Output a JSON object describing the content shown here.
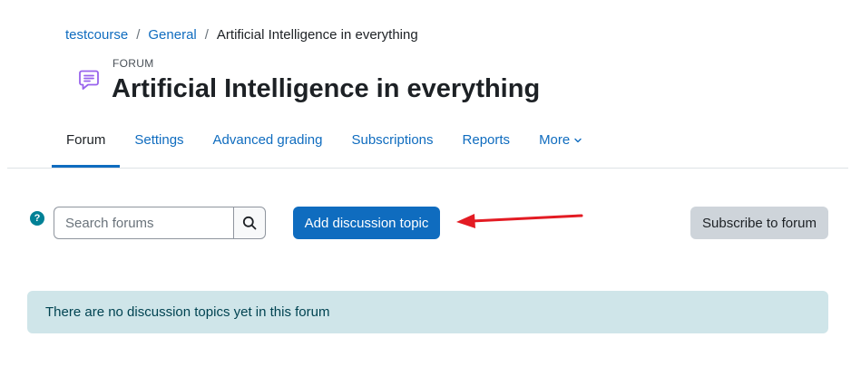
{
  "breadcrumb": {
    "items": [
      {
        "label": "testcourse"
      },
      {
        "label": "General"
      }
    ],
    "current": "Artificial Intelligence in everything",
    "separator": "/"
  },
  "header": {
    "activity_type": "FORUM",
    "title": "Artificial Intelligence in everything",
    "icon": "forum-icon"
  },
  "tabs": [
    {
      "label": "Forum",
      "active": true
    },
    {
      "label": "Settings"
    },
    {
      "label": "Advanced grading"
    },
    {
      "label": "Subscriptions"
    },
    {
      "label": "Reports"
    },
    {
      "label": "More",
      "has_dropdown": true
    }
  ],
  "search": {
    "placeholder": "Search forums",
    "value": "",
    "button_icon": "search-icon"
  },
  "help": {
    "glyph": "?"
  },
  "actions": {
    "add_discussion_label": "Add discussion topic",
    "subscribe_label": "Subscribe to forum"
  },
  "annotation": {
    "type": "red-arrow",
    "color": "#e31b23"
  },
  "notice": {
    "text": "There are no discussion topics yet in this forum"
  },
  "colors": {
    "link": "#0f6cbf",
    "primary_button": "#0f6cbf",
    "secondary_button": "#ced4da",
    "notice_bg": "#cfe5e9",
    "help_icon_bg": "#008196",
    "forum_icon": "#9863ed"
  }
}
